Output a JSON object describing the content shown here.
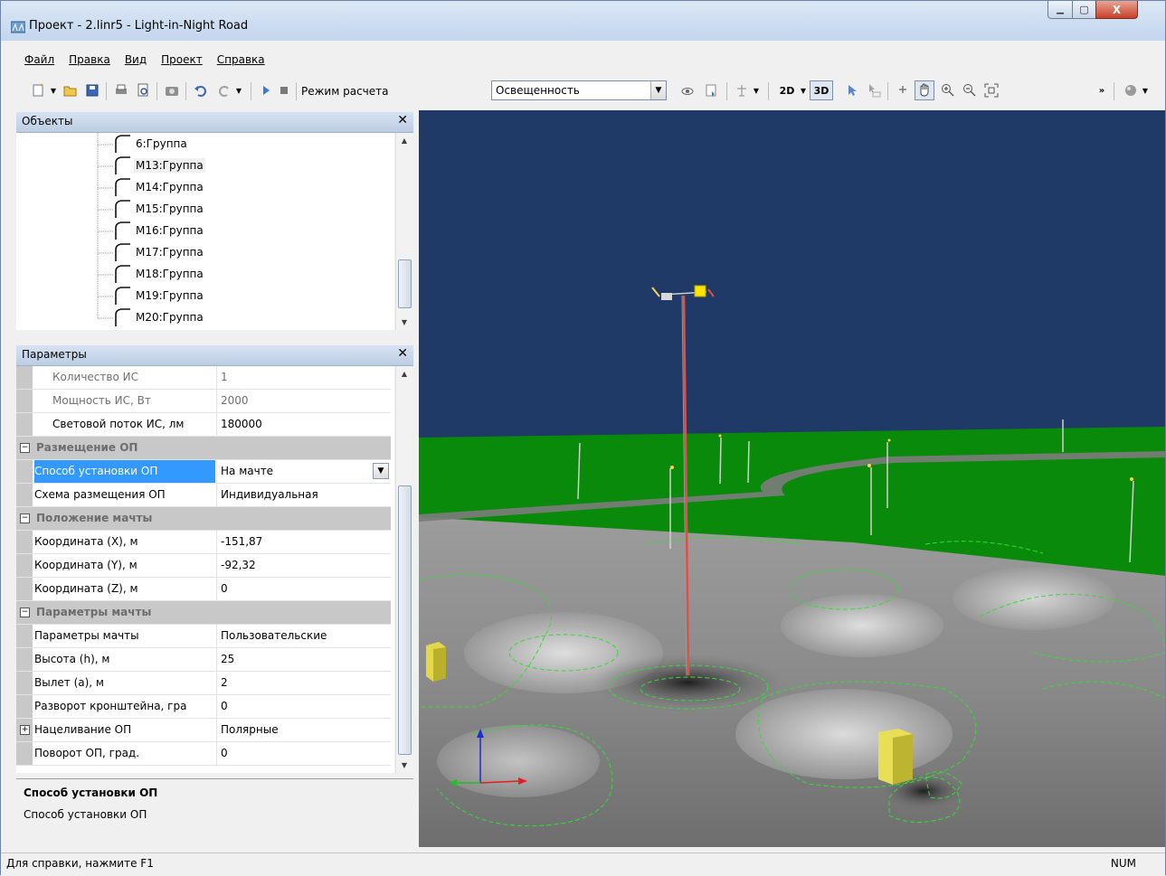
{
  "window": {
    "title": "Проект - 2.linr5 - Light-in-Night Road",
    "minimize_glyph": "▁",
    "maximize_glyph": "▢",
    "close_glyph": "X"
  },
  "menu": [
    "Файл",
    "Правка",
    "Вид",
    "Проект",
    "Справка"
  ],
  "toolbar": {
    "mode_label": "Режим расчета",
    "mode_value": "Освещенность",
    "view_2d": "2D",
    "view_3d": "3D",
    "icons": [
      "new-icon",
      "open-icon",
      "save-icon",
      "print-icon",
      "print-preview-icon",
      "camera-icon",
      "undo-icon",
      "redo-icon",
      "play-icon",
      "stop-icon",
      "eye-icon",
      "document-icon",
      "luminaire-icon",
      "select-arrow-icon",
      "select-xyz-icon",
      "pointer-icon",
      "hand-icon",
      "zoom-in-icon",
      "zoom-out-icon",
      "zoom-fit-icon",
      "overflow-icon",
      "sphere-icon"
    ]
  },
  "objects_panel": {
    "title": "Объекты",
    "close_glyph": "✕",
    "items": [
      "6:Группа",
      "M13:Группа",
      "M14:Группа",
      "M15:Группа",
      "M16:Группа",
      "M17:Группа",
      "M18:Группа",
      "M19:Группа",
      "M20:Группа"
    ],
    "selected_index": 1
  },
  "params_panel": {
    "title": "Параметры",
    "close_glyph": "✕",
    "rows": [
      {
        "type": "prop",
        "name": "Количество ИС",
        "value": "1",
        "readonly": true
      },
      {
        "type": "prop",
        "name": "Мощность ИС, Вт",
        "value": "2000",
        "readonly": true
      },
      {
        "type": "prop",
        "name": "Световой поток ИС, лм",
        "value": "180000",
        "readonly": false
      },
      {
        "type": "cat",
        "name": "Размещение ОП",
        "glyph": "−"
      },
      {
        "type": "prop",
        "name": "Способ установки ОП",
        "value": "На мачте",
        "selected": true,
        "dropdown": true
      },
      {
        "type": "prop",
        "name": "Схема размещения ОП",
        "value": "Индивидуальная"
      },
      {
        "type": "cat",
        "name": "Положение мачты",
        "glyph": "−"
      },
      {
        "type": "prop",
        "name": "Координата (X), м",
        "value": "-151,87"
      },
      {
        "type": "prop",
        "name": "Координата (Y), м",
        "value": "-92,32"
      },
      {
        "type": "prop",
        "name": "Координата (Z), м",
        "value": "0"
      },
      {
        "type": "cat",
        "name": "Параметры мачты",
        "glyph": "−"
      },
      {
        "type": "prop",
        "name": "Параметры мачты",
        "value": "Пользовательские"
      },
      {
        "type": "prop",
        "name": "Высота (h), м",
        "value": "25"
      },
      {
        "type": "prop",
        "name": "Вылет (a), м",
        "value": "2"
      },
      {
        "type": "prop",
        "name": "Разворот кронштейна, гра",
        "value": "0"
      },
      {
        "type": "prop",
        "name": "Нацеливание ОП",
        "value": "Полярные",
        "expandable": true,
        "glyph": "+"
      },
      {
        "type": "prop",
        "name": "Поворот ОП, град.",
        "value": "0"
      }
    ]
  },
  "description": {
    "heading": "Способ установки ОП",
    "body": "Способ установки ОП"
  },
  "statusbar": {
    "left": "Для справки, нажмите F1",
    "right": "NUM"
  },
  "colors": {
    "sky": "#1f3a66",
    "grass": "#0a8a0a",
    "selection": "#3399ff",
    "contour": "#33dd33",
    "mast": "#e0504a",
    "block": "#e2d84a"
  }
}
